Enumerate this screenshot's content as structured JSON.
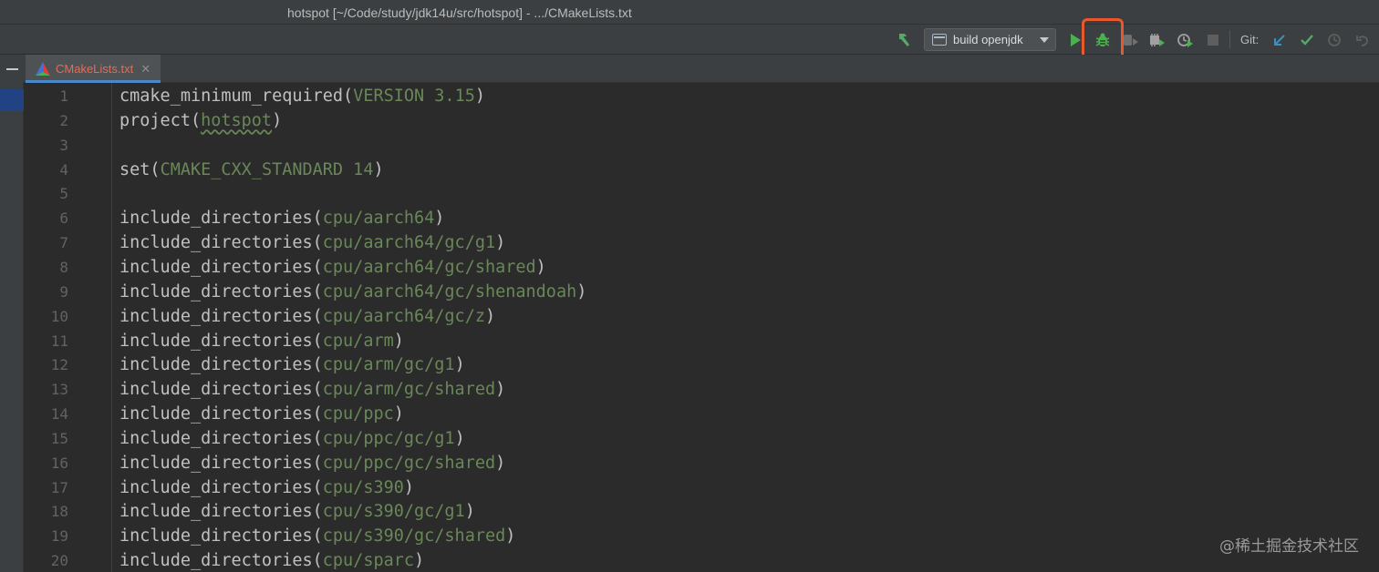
{
  "window": {
    "title": "hotspot [~/Code/study/jdk14u/src/hotspot] - .../CMakeLists.txt"
  },
  "toolbar": {
    "run_config_label": "build openjdk",
    "git_label": "Git:",
    "icons": [
      "hammer-icon",
      "run-config-icon",
      "run-icon",
      "debug-icon",
      "coverage-icon",
      "profile-icon",
      "attach-icon",
      "stop-icon",
      "git-update-icon",
      "git-commit-icon",
      "git-history-icon",
      "git-revert-icon"
    ],
    "colors": {
      "run": "#4caf50",
      "debug": "#4caf50",
      "highlight": "#e8582c",
      "git_update": "#3592c4",
      "git_commit": "#59a869"
    }
  },
  "tabs": [
    {
      "label": "CMakeLists.txt",
      "close": "✕",
      "active": true
    }
  ],
  "editor": {
    "lines": [
      {
        "num": "1",
        "fn": "cmake_minimum_required",
        "arg": "VERSION 3.15"
      },
      {
        "num": "2",
        "fn": "project",
        "arg": "hotspot",
        "squiggle": true
      },
      {
        "num": "3",
        "fn": "",
        "arg": ""
      },
      {
        "num": "4",
        "fn": "set",
        "arg": "CMAKE_CXX_STANDARD 14"
      },
      {
        "num": "5",
        "fn": "",
        "arg": ""
      },
      {
        "num": "6",
        "fn": "include_directories",
        "arg": "cpu/aarch64"
      },
      {
        "num": "7",
        "fn": "include_directories",
        "arg": "cpu/aarch64/gc/g1"
      },
      {
        "num": "8",
        "fn": "include_directories",
        "arg": "cpu/aarch64/gc/shared"
      },
      {
        "num": "9",
        "fn": "include_directories",
        "arg": "cpu/aarch64/gc/shenandoah"
      },
      {
        "num": "10",
        "fn": "include_directories",
        "arg": "cpu/aarch64/gc/z"
      },
      {
        "num": "11",
        "fn": "include_directories",
        "arg": "cpu/arm"
      },
      {
        "num": "12",
        "fn": "include_directories",
        "arg": "cpu/arm/gc/g1"
      },
      {
        "num": "13",
        "fn": "include_directories",
        "arg": "cpu/arm/gc/shared"
      },
      {
        "num": "14",
        "fn": "include_directories",
        "arg": "cpu/ppc"
      },
      {
        "num": "15",
        "fn": "include_directories",
        "arg": "cpu/ppc/gc/g1"
      },
      {
        "num": "16",
        "fn": "include_directories",
        "arg": "cpu/ppc/gc/shared"
      },
      {
        "num": "17",
        "fn": "include_directories",
        "arg": "cpu/s390"
      },
      {
        "num": "18",
        "fn": "include_directories",
        "arg": "cpu/s390/gc/g1"
      },
      {
        "num": "19",
        "fn": "include_directories",
        "arg": "cpu/s390/gc/shared"
      },
      {
        "num": "20",
        "fn": "include_directories",
        "arg": "cpu/sparc"
      }
    ]
  },
  "watermark": "@稀土掘金技术社区"
}
